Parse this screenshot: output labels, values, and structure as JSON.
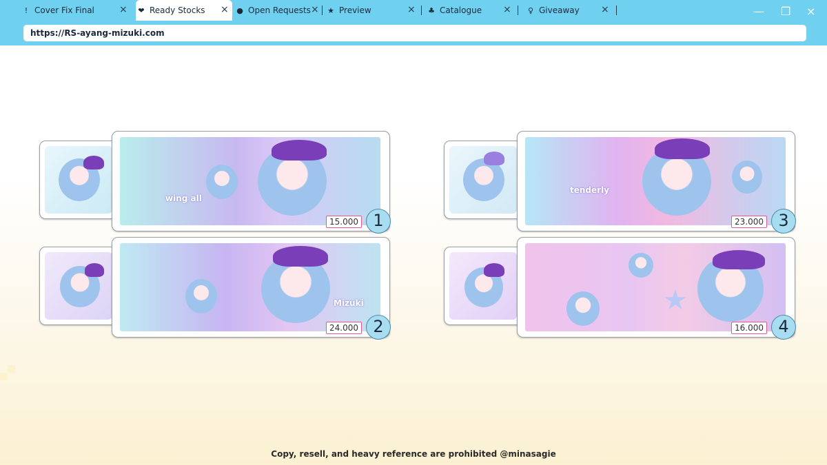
{
  "browser": {
    "tabs": [
      {
        "icon": "!",
        "label": "Cover Fix Final",
        "active": false
      },
      {
        "icon": "❤",
        "label": "Ready Stocks",
        "active": true
      },
      {
        "icon": "●",
        "label": "Open Requests",
        "active": false
      },
      {
        "icon": "★",
        "label": "Preview",
        "active": false
      },
      {
        "icon": "♣",
        "label": "Catalogue",
        "active": false
      },
      {
        "icon": "♀",
        "label": "Giveaway",
        "active": false
      }
    ],
    "tab_close": "×",
    "tab_sep": "|",
    "minimize": "—",
    "restore": "❐",
    "url": "https://RS-ayang-mizuki.com"
  },
  "items": [
    {
      "price": "15.000",
      "number": "1",
      "art_text": "wing all"
    },
    {
      "price": "24.000",
      "number": "2",
      "art_text": "Mizuki"
    },
    {
      "price": "23.000",
      "number": "3",
      "art_text": "tenderly"
    },
    {
      "price": "16.000",
      "number": "4",
      "art_text": ""
    }
  ],
  "colors": {
    "titlebar": "#6fd0f0",
    "badge": "#a8dcf0",
    "price_border": "#e25a8a"
  },
  "footer": "Copy, resell, and heavy reference are prohibited @minasagie"
}
